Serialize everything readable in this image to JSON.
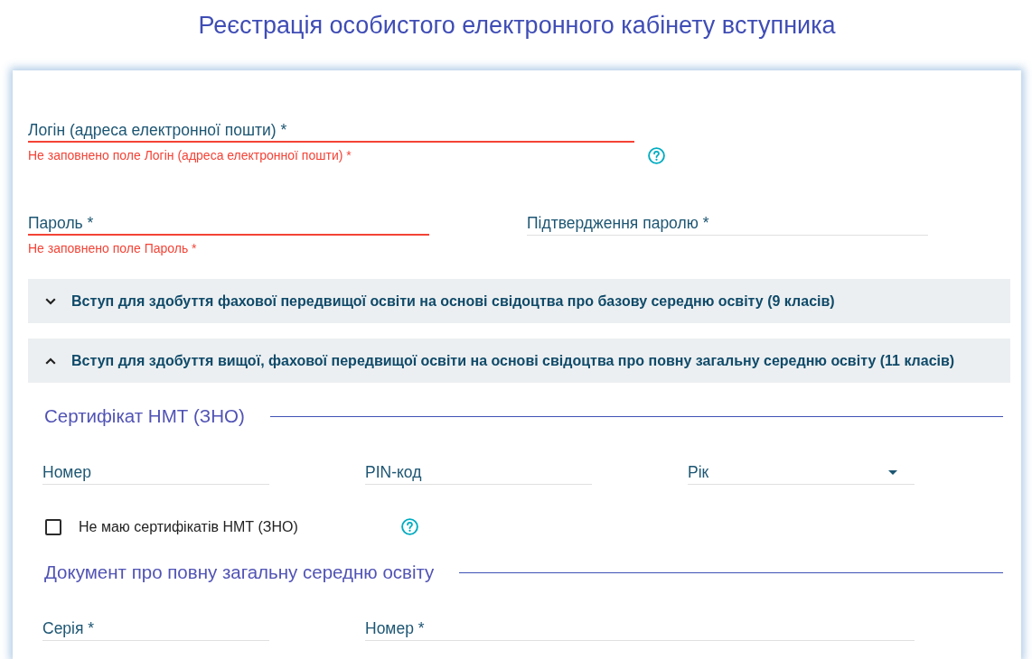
{
  "title": "Реєстрація особистого електронного кабінету вступника",
  "credential_rows": [
    {
      "fields": [
        {
          "placeholder": "Логін (адреса електронної пошти) *",
          "invalid": true,
          "error": "Не заповнено поле Логін (адреса електронної пошти) *"
        }
      ],
      "help": true
    },
    {
      "fields": [
        {
          "placeholder": "Пароль *",
          "invalid": true,
          "error": "Не заповнено поле Пароль *"
        },
        {
          "placeholder": "Підтвердження паролю *",
          "invalid": false
        }
      ]
    }
  ],
  "sections": [
    {
      "title": "Вступ для здобуття фахової передвищої освіти на основі свідоцтва про базову середню освіту (9 класів)",
      "expanded": false
    },
    {
      "title": "Вступ для здобуття вищої, фахової передвищої освіти на основі свідоцтва про повну загальну середню освіту (11 класів)",
      "expanded": true,
      "groups": [
        {
          "heading": "Сертифікат НМТ (ЗНО)",
          "fields": [
            {
              "kind": "text",
              "placeholder": "Номер"
            },
            {
              "kind": "text",
              "placeholder": "PIN-код"
            },
            {
              "kind": "select",
              "placeholder": "Рік"
            }
          ],
          "checkbox": {
            "label": "Не маю сертифікатів НМТ (ЗНО)",
            "checked": false,
            "help": true
          }
        },
        {
          "heading": "Документ про повну загальну середню освіту",
          "fields": [
            {
              "kind": "text",
              "placeholder": "Серія *"
            },
            {
              "kind": "text",
              "placeholder": "Номер *"
            }
          ]
        }
      ]
    }
  ]
}
